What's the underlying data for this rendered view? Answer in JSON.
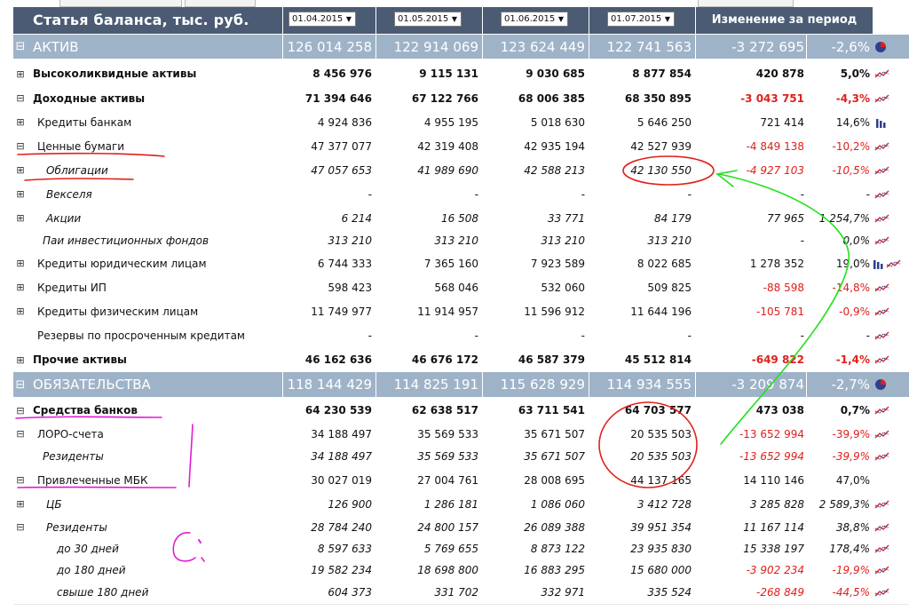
{
  "header": {
    "title": "Статья баланса, тыс. руб.",
    "dates": [
      "01.04.2015",
      "01.05.2015",
      "01.06.2015",
      "01.07.2015"
    ],
    "dropdown_arrow": "▼",
    "change_header": "Изменение за период"
  },
  "icons": {
    "toggle_expanded": "⊟",
    "toggle_collapsed": "⊞",
    "pie": "pie-chart-icon",
    "trend": "trend-line-icon",
    "bar": "bar-chart-icon"
  },
  "colors": {
    "header_bg": "#4a5b73",
    "section_bg": "#9fb3c8",
    "negative": "#e0201b",
    "annotation_red": "#e0201b",
    "annotation_green": "#22e01e",
    "annotation_magenta": "#e21bd4"
  },
  "rows": [
    {
      "label": "АКТИВ",
      "toggle": "⊟",
      "section": true,
      "values": [
        "126 014 258",
        "122 914 069",
        "123 624 449",
        "122 741 563"
      ],
      "delta": "-3 272 695",
      "pct": "-2,6%",
      "neg": true,
      "icon": "pie"
    },
    {
      "label": "Высоколиквидные активы",
      "toggle": "⊞",
      "bold": true,
      "values": [
        "8 456 976",
        "9 115 131",
        "9 030 685",
        "8 877 854"
      ],
      "delta": "420 878",
      "pct": "5,0%",
      "neg": false,
      "icon": "trend"
    },
    {
      "label": "Доходные активы",
      "toggle": "⊟",
      "bold": true,
      "values": [
        "71 394 646",
        "67 122 766",
        "68 006 385",
        "68 350 895"
      ],
      "delta": "-3 043 751",
      "pct": "-4,3%",
      "neg": true,
      "icon": "trend"
    },
    {
      "label": "Кредиты банкам",
      "toggle": "⊞",
      "values": [
        "4 924 836",
        "4 955 195",
        "5 018 630",
        "5 646 250"
      ],
      "delta": "721 414",
      "pct": "14,6%",
      "neg": false,
      "icon": "bar"
    },
    {
      "label": "Ценные бумаги",
      "toggle": "⊟",
      "values": [
        "47 377 077",
        "42 319 408",
        "42 935 194",
        "42 527 939"
      ],
      "delta": "-4 849 138",
      "pct": "-10,2%",
      "neg": true,
      "icon": "trend"
    },
    {
      "label": "Облигации",
      "toggle": "⊞",
      "italic": true,
      "values": [
        "47 057 653",
        "41 989 690",
        "42 588 213",
        "42 130 550"
      ],
      "delta": "-4 927 103",
      "pct": "-10,5%",
      "neg": true,
      "icon": "trend"
    },
    {
      "label": "Векселя",
      "toggle": "⊞",
      "italic": true,
      "values": [
        "-",
        "-",
        "-",
        "-"
      ],
      "delta": "-",
      "pct": "-",
      "neg": false,
      "icon": "trend"
    },
    {
      "label": "Акции",
      "toggle": "⊞",
      "italic": true,
      "values": [
        "6 214",
        "16 508",
        "33 771",
        "84 179"
      ],
      "delta": "77 965",
      "pct": "1 254,7%",
      "neg": false,
      "icon": "trend"
    },
    {
      "label": "Паи инвестиционных фондов",
      "toggle": "",
      "italic": true,
      "values": [
        "313 210",
        "313 210",
        "313 210",
        "313 210"
      ],
      "delta": "-",
      "pct": "0,0%",
      "neg": false,
      "icon": "trend"
    },
    {
      "label": "Кредиты юридическим лицам",
      "toggle": "⊞",
      "values": [
        "6 744 333",
        "7 365 160",
        "7 923 589",
        "8 022 685"
      ],
      "delta": "1 278 352",
      "pct": "19,0%",
      "neg": false,
      "icon": "bar-trend"
    },
    {
      "label": "Кредиты ИП",
      "toggle": "⊞",
      "values": [
        "598 423",
        "568 046",
        "532 060",
        "509 825"
      ],
      "delta": "-88 598",
      "pct": "-14,8%",
      "neg": true,
      "icon": "trend"
    },
    {
      "label": "Кредиты физическим лицам",
      "toggle": "⊞",
      "values": [
        "11 749 977",
        "11 914 957",
        "11 596 912",
        "11 644 196"
      ],
      "delta": "-105 781",
      "pct": "-0,9%",
      "neg": true,
      "icon": "trend"
    },
    {
      "label": "Резервы по просроченным кредитам",
      "toggle": "",
      "values": [
        "-",
        "-",
        "-",
        "-"
      ],
      "delta": "-",
      "pct": "-",
      "neg": false,
      "icon": "trend"
    },
    {
      "label": "Прочие активы",
      "toggle": "⊞",
      "bold": true,
      "values": [
        "46 162 636",
        "46 676 172",
        "46 587 379",
        "45 512 814"
      ],
      "delta": "-649 822",
      "pct": "-1,4%",
      "neg": true,
      "icon": "trend"
    },
    {
      "label": "ОБЯЗАТЕЛЬСТВА",
      "toggle": "⊟",
      "section": true,
      "values": [
        "118 144 429",
        "114 825 191",
        "115 628 929",
        "114 934 555"
      ],
      "delta": "-3 209 874",
      "pct": "-2,7%",
      "neg": true,
      "icon": "pie"
    },
    {
      "label": "Средства банков",
      "toggle": "⊟",
      "bold": true,
      "values": [
        "64 230 539",
        "62 638 517",
        "63 711 541",
        "64 703 577"
      ],
      "delta": "473 038",
      "pct": "0,7%",
      "neg": false,
      "icon": "trend"
    },
    {
      "label": "ЛОРО-счета",
      "toggle": "⊟",
      "values": [
        "34 188 497",
        "35 569 533",
        "35 671 507",
        "20 535 503"
      ],
      "delta": "-13 652 994",
      "pct": "-39,9%",
      "neg": true,
      "icon": "trend"
    },
    {
      "label": "Резиденты",
      "toggle": "",
      "italic": true,
      "values": [
        "34 188 497",
        "35 569 533",
        "35 671 507",
        "20 535 503"
      ],
      "delta": "-13 652 994",
      "pct": "-39,9%",
      "neg": true,
      "icon": "trend"
    },
    {
      "label": "Привлеченные МБК",
      "toggle": "⊟",
      "values": [
        "30 027 019",
        "27 004 761",
        "28 008 695",
        "44 137 165"
      ],
      "delta": "14 110 146",
      "pct": "47,0%",
      "neg": false,
      "icon": ""
    },
    {
      "label": "ЦБ",
      "toggle": "⊞",
      "italic": true,
      "values": [
        "126 900",
        "1 286 181",
        "1 086 060",
        "3 412 728"
      ],
      "delta": "3 285 828",
      "pct": "2 589,3%",
      "neg": false,
      "icon": "trend"
    },
    {
      "label": "Резиденты",
      "toggle": "⊟",
      "italic": true,
      "values": [
        "28 784 240",
        "24 800 157",
        "26 089 388",
        "39 951 354"
      ],
      "delta": "11 167 114",
      "pct": "38,8%",
      "neg": false,
      "icon": "trend"
    },
    {
      "label": "до 30 дней",
      "toggle": "",
      "italic": true,
      "values": [
        "8 597 633",
        "5 769 655",
        "8 873 122",
        "23 935 830"
      ],
      "delta": "15 338 197",
      "pct": "178,4%",
      "neg": false,
      "icon": "trend"
    },
    {
      "label": "до 180 дней",
      "toggle": "",
      "italic": true,
      "values": [
        "19 582 234",
        "18 698 800",
        "16 883 295",
        "15 680 000"
      ],
      "delta": "-3 902 234",
      "pct": "-19,9%",
      "neg": true,
      "icon": "trend"
    },
    {
      "label": "свыше 180 дней",
      "toggle": "",
      "italic": true,
      "values": [
        "604 373",
        "331 702",
        "332 971",
        "335 524"
      ],
      "delta": "-268 849",
      "pct": "-44,5%",
      "neg": true,
      "icon": "trend"
    }
  ]
}
